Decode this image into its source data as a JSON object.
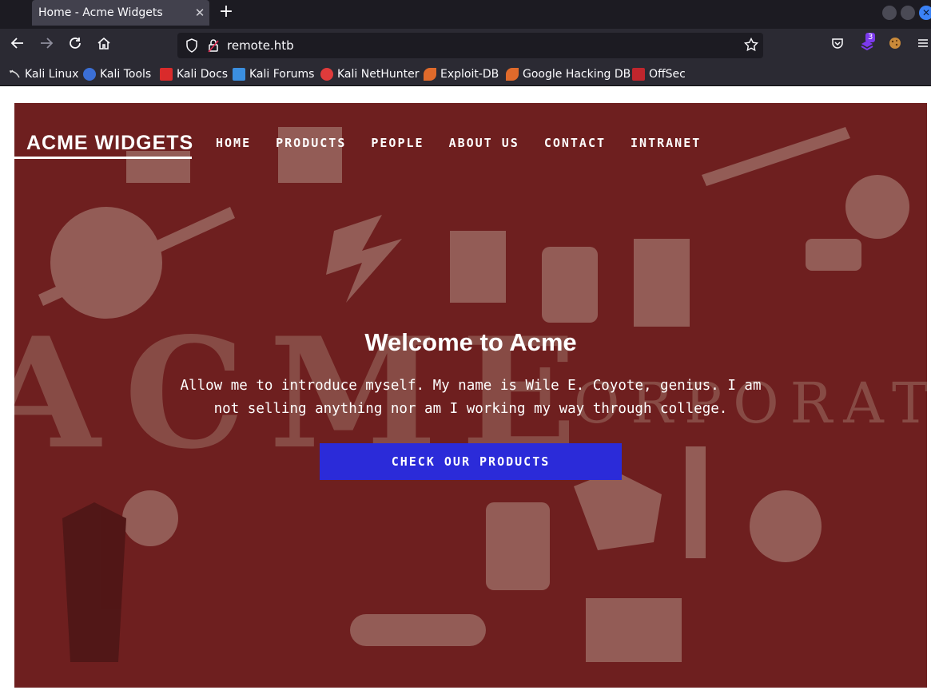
{
  "browser": {
    "tab": {
      "title": "Home - Acme Widgets",
      "close": "✕"
    },
    "new_tab": "+",
    "url": "remote.htb",
    "extension_badge": "3",
    "bookmarks": [
      {
        "label": "Kali Linux"
      },
      {
        "label": "Kali Tools"
      },
      {
        "label": "Kali Docs"
      },
      {
        "label": "Kali Forums"
      },
      {
        "label": "Kali NetHunter"
      },
      {
        "label": "Exploit-DB"
      },
      {
        "label": "Google Hacking DB"
      },
      {
        "label": "OffSec"
      }
    ]
  },
  "site": {
    "logo": "ACME WIDGETS",
    "nav": [
      "HOME",
      "PRODUCTS",
      "PEOPLE",
      "ABOUT US",
      "CONTACT",
      "INTRANET"
    ],
    "hero": {
      "title": "Welcome to Acme",
      "text": "Allow me to introduce myself. My name is Wile E. Coyote, genius. I am not selling anything nor am I working my way through college.",
      "button": "CHECK OUR PRODUCTS"
    }
  },
  "colors": {
    "hero_bg": "#6b1e1e",
    "button": "#2b2bd9",
    "browser_dark": "#1c1b22",
    "browser_toolbar": "#2b2a33"
  }
}
